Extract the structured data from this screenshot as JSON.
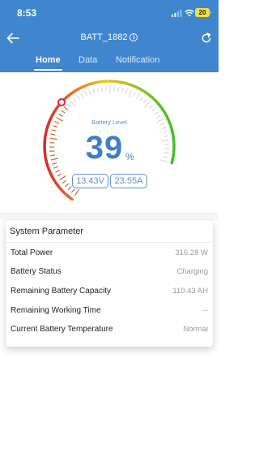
{
  "status_bar": {
    "time": "8:53",
    "battery_level": "20"
  },
  "header": {
    "title": "BATT_1882",
    "info_glyph": "i",
    "tabs": [
      {
        "label": "Home",
        "active": true
      },
      {
        "label": "Data",
        "active": false
      },
      {
        "label": "Notification",
        "active": false
      }
    ]
  },
  "gauge": {
    "label": "Battery Level",
    "value": "39",
    "unit": "%",
    "level_fraction": 0.39,
    "voltage": "13.43V",
    "current": "23.55A"
  },
  "system_parameter": {
    "title": "System Parameter",
    "rows": [
      {
        "label": "Total Power",
        "value": "316.28 W"
      },
      {
        "label": "Battery Status",
        "value": "Charging"
      },
      {
        "label": "Remaining Battery Capacity",
        "value": "110.43 AH"
      },
      {
        "label": "Remaining Working Time",
        "value": "--"
      },
      {
        "label": "Current Battery Temperature",
        "value": "Normal"
      }
    ]
  },
  "colors": {
    "header": "#3f86cf",
    "accent": "#3f7fc4",
    "gauge_start": "#d42a2a",
    "gauge_mid": "#f0c020",
    "gauge_end": "#3fbf2a"
  }
}
